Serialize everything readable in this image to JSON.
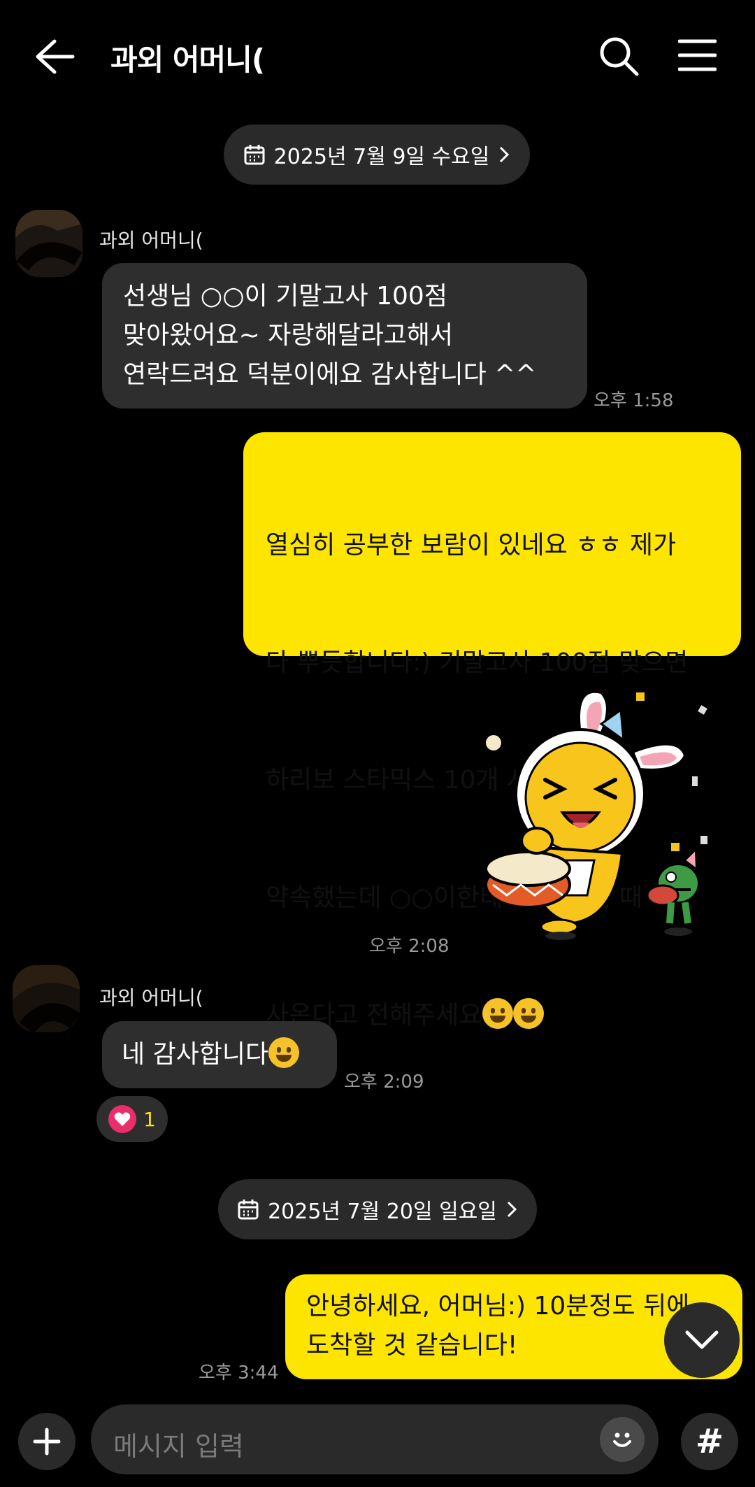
{
  "header": {
    "title": "과외 어머니(",
    "icons": [
      "back-arrow-icon",
      "search-icon",
      "menu-icon"
    ]
  },
  "date_dividers": [
    {
      "label": "2025년 7월 9일 수요일"
    },
    {
      "label": "2025년 7월 20일 일요일"
    }
  ],
  "messages": {
    "m1": {
      "sender": "과외 어머니(",
      "text": "선생님 ○○이 기말고사 100점\n맞아왔어요~ 자랑해달라고해서\n연락드려요 덕분이에요 감사합니다 ^^",
      "time": "오후 1:58"
    },
    "m2": {
      "text_line1": "열심히 공부한 보람이 있네요 ㅎㅎ 제가",
      "text_line2": "다 뿌듯합니다:) 기말고사 100점 맞으면",
      "text_line3": "하리보 스타믹스 10개 사가겠다고",
      "text_line4": "약속했는데 ○○이한테 다음 수업 때",
      "text_line5": "사온다고 전해주세요"
    },
    "m3": {
      "sticker": "kakao-friends-drum-sticker",
      "time": "오후 2:08"
    },
    "m4": {
      "sender": "과외 어머니(",
      "text": "네 감사합니다",
      "time": "오후 2:09",
      "reaction_count": "1"
    },
    "m5": {
      "text": "안녕하세요, 어머님:) 10분정도 뒤에\n도착할 것 같습니다!",
      "time": "오후 3:44"
    }
  },
  "composer": {
    "placeholder": "메시지 입력",
    "hash_label": "#"
  },
  "colors": {
    "background": "#000000",
    "sent_bubble": "#fee500",
    "received_bubble": "#2e2e2e",
    "reaction_heart": "#e92e6a"
  }
}
